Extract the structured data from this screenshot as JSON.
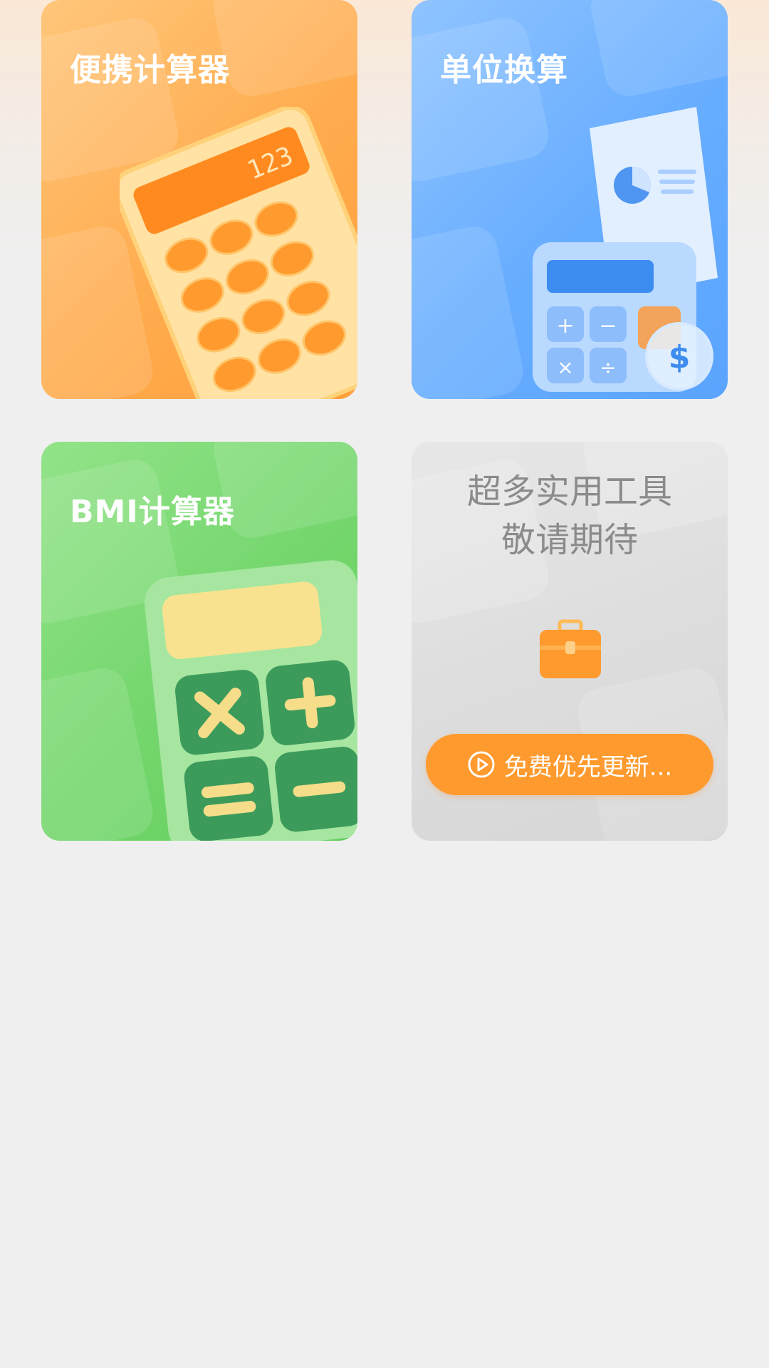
{
  "tools": [
    {
      "title": "便携计算器",
      "icon": "calculator-illustration",
      "color": "#ffac4f"
    },
    {
      "title": "单位换算",
      "icon": "unit-conversion-illustration",
      "color": "#67adff"
    },
    {
      "title": "BMI计算器",
      "icon": "bmi-calculator-illustration",
      "color": "#73d66c"
    }
  ],
  "calculator_display": "123",
  "more_card": {
    "line1": "超多实用工具",
    "line2": "敬请期待",
    "icon": "toolbox-icon",
    "button_label": "免费优先更新...",
    "button_icon": "play-circle-icon",
    "button_color": "#ff9a2e"
  }
}
